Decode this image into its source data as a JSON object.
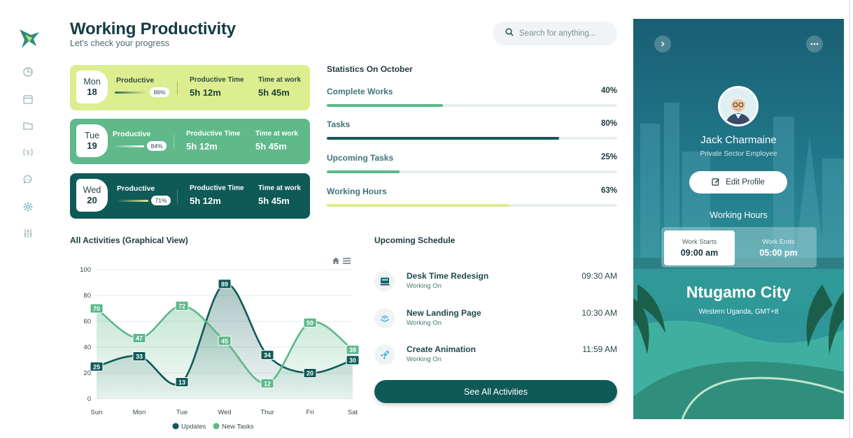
{
  "header": {
    "title": "Working Productivity",
    "subtitle": "Let's check your progress",
    "search_placeholder": "Search for anything..."
  },
  "sidebar": {
    "icons": [
      "logo-icon",
      "pie-chart-icon",
      "calendar-icon",
      "folder-icon",
      "dollar-icon",
      "chat-icon",
      "settings-icon",
      "sliders-icon"
    ],
    "active_color": "#2f8c7c"
  },
  "day_cards": [
    {
      "day": "Mon",
      "date": "18",
      "productive_label": "Productive",
      "productive_pct": "86%",
      "productive_time_label": "Productive Time",
      "productive_time": "5h 12m",
      "time_at_work_label": "Time at work",
      "time_at_work": "5h 45m",
      "bg": "#dcee8f"
    },
    {
      "day": "Tue",
      "date": "19",
      "productive_label": "Productive",
      "productive_pct": "84%",
      "productive_time_label": "Productive Time",
      "productive_time": "5h 12m",
      "time_at_work_label": "Time at work",
      "time_at_work": "5h 45m",
      "bg": "#5fb98a"
    },
    {
      "day": "Wed",
      "date": "20",
      "productive_label": "Productive",
      "productive_pct": "71%",
      "productive_time_label": "Productive Time",
      "productive_time": "5h 12m",
      "time_at_work_label": "Time at work",
      "time_at_work": "5h 45m",
      "bg": "#0f5a57"
    }
  ],
  "statistics": {
    "title": "Statistics On October",
    "items": [
      {
        "label": "Complete Works",
        "value": "40%",
        "fraction": 0.4,
        "color": "#5bb98a"
      },
      {
        "label": "Tasks",
        "value": "80%",
        "fraction": 0.8,
        "color": "#0f5a57"
      },
      {
        "label": "Upcoming Tasks",
        "value": "25%",
        "fraction": 0.25,
        "color": "#5bb98a"
      },
      {
        "label": "Working Hours",
        "value": "63%",
        "fraction": 0.63,
        "color": "#dcee8f"
      }
    ]
  },
  "chart_data": {
    "type": "area",
    "title": "All Activities (Graphical View)",
    "categories": [
      "Sun",
      "Mon",
      "Tue",
      "Wed",
      "Thur",
      "Fri",
      "Sat"
    ],
    "ylim": [
      0,
      100
    ],
    "yticks": [
      "0",
      "20",
      "40",
      "60",
      "80",
      "100"
    ],
    "grid": true,
    "legend": "bottom",
    "series": [
      {
        "name": "Updates",
        "values": [
          25,
          33,
          13,
          89,
          34,
          20,
          30
        ],
        "color": "#0f5a57"
      },
      {
        "name": "New Tasks",
        "values": [
          70,
          47,
          72,
          45,
          12,
          59,
          38
        ],
        "color": "#5bb98a"
      }
    ]
  },
  "schedule": {
    "title": "Upcoming Schedule",
    "items": [
      {
        "name": "Desk Time Redesign",
        "status": "Working On",
        "time": "09:30 AM",
        "icon": "monitor-icon"
      },
      {
        "name": "New Landing Page",
        "status": "Working On",
        "time": "10:30 AM",
        "icon": "layers-icon"
      },
      {
        "name": "Create Animation",
        "status": "Working On",
        "time": "11:59 AM",
        "icon": "rocket-icon"
      }
    ],
    "button_label": "See All Activities"
  },
  "profile": {
    "name": "Jack Charmaine",
    "role": "Private Sector Employee",
    "edit_label": "Edit Profile",
    "working_hours_title": "Working Hours",
    "work_starts_label": "Work Starts",
    "work_starts": "09:00 am",
    "work_ends_label": "Work Ends",
    "work_ends": "05:00 pm",
    "city": "Ntugamo City",
    "region": "Western Uganda, GMT+8"
  }
}
